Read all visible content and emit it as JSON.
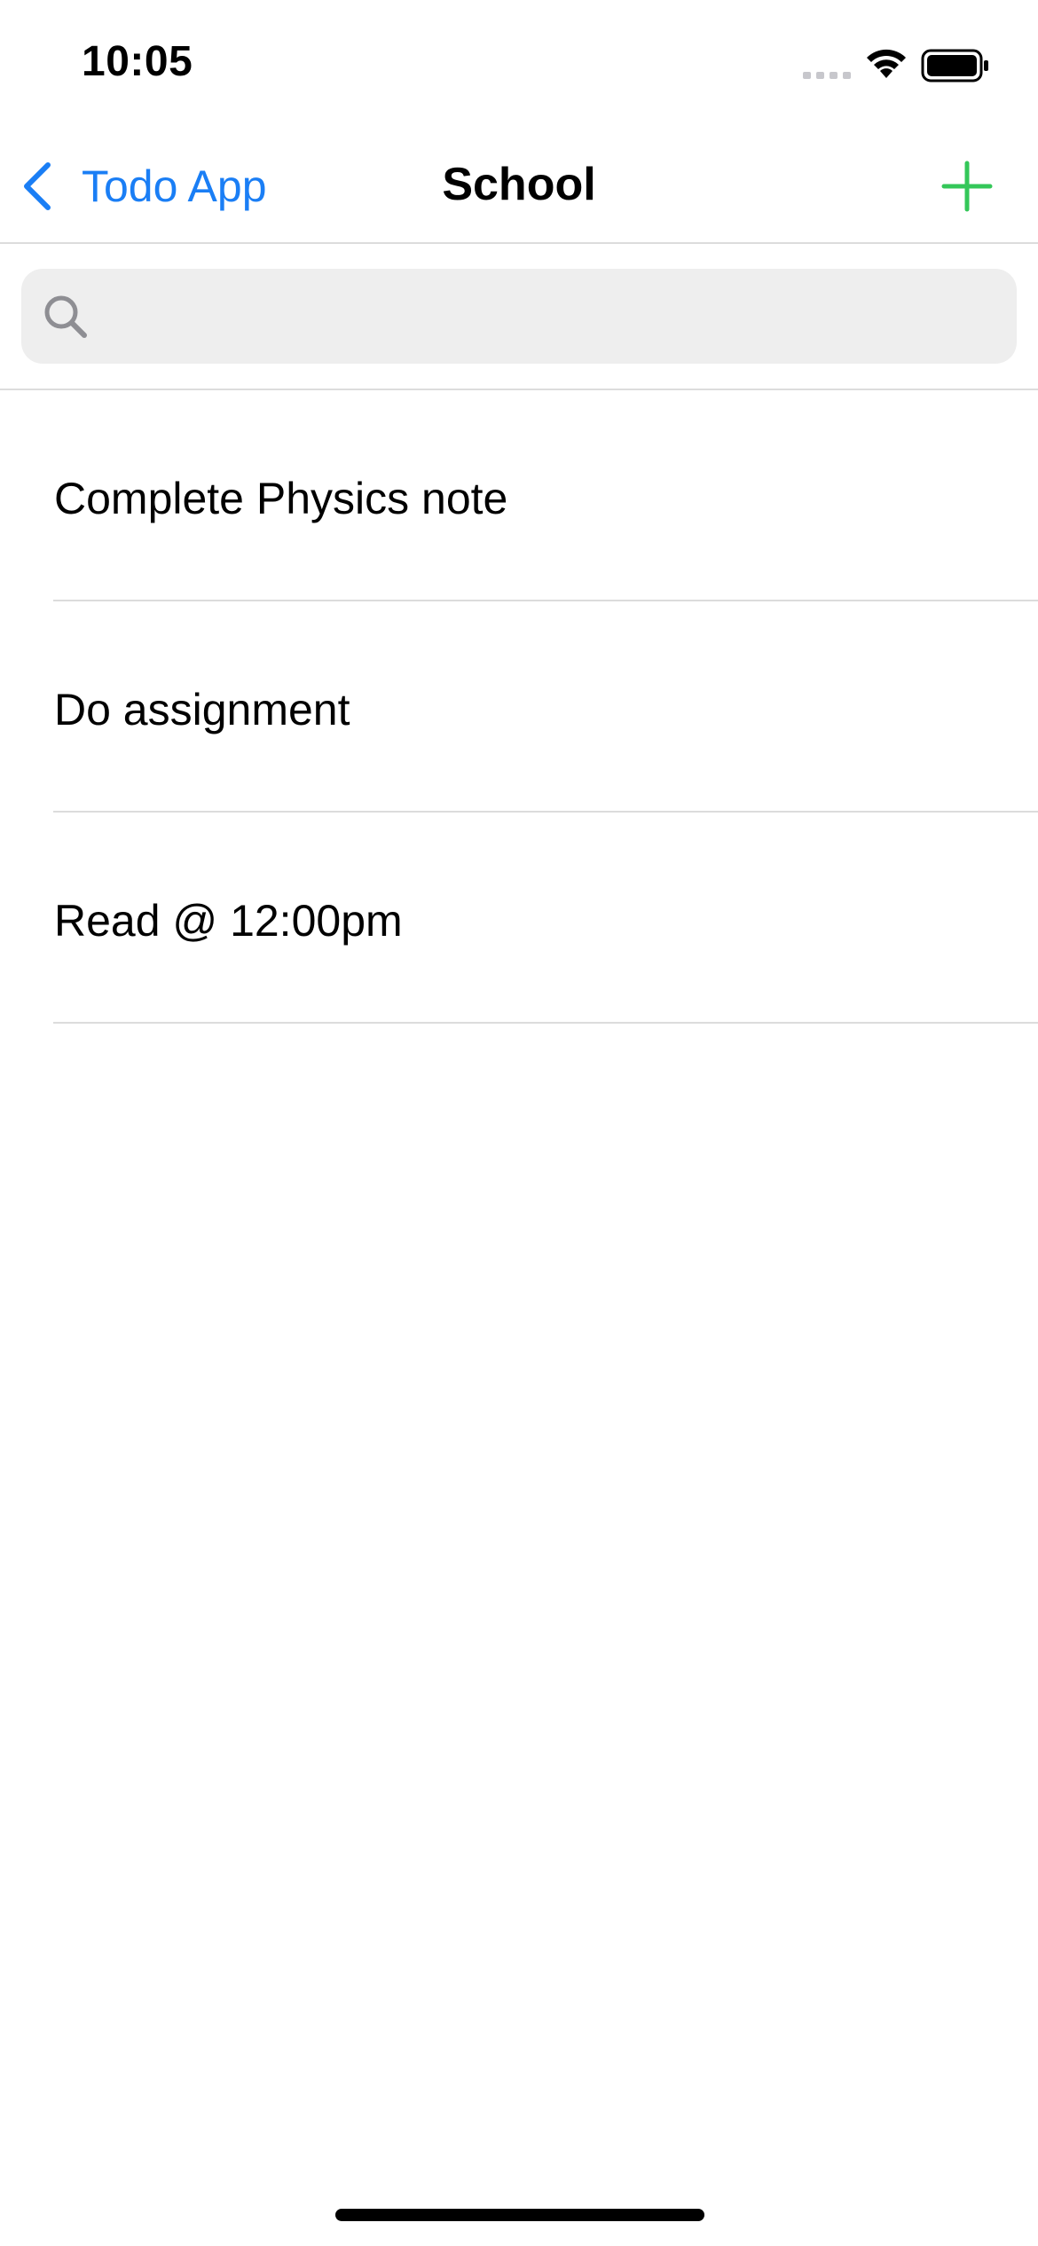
{
  "status_bar": {
    "time": "10:05"
  },
  "nav": {
    "back_label": "Todo App",
    "title": "School",
    "back_icon": "chevron-left-icon",
    "add_icon": "plus-icon"
  },
  "search": {
    "value": "",
    "placeholder": "",
    "icon": "search-icon"
  },
  "todos": [
    {
      "title": "Complete Physics note"
    },
    {
      "title": "Do assignment"
    },
    {
      "title": "Read @ 12:00pm"
    }
  ],
  "colors": {
    "accent_blue": "#1a7ef5",
    "add_green": "#34c759",
    "separator": "#dcdcdc",
    "search_bg": "#eeeeee"
  }
}
